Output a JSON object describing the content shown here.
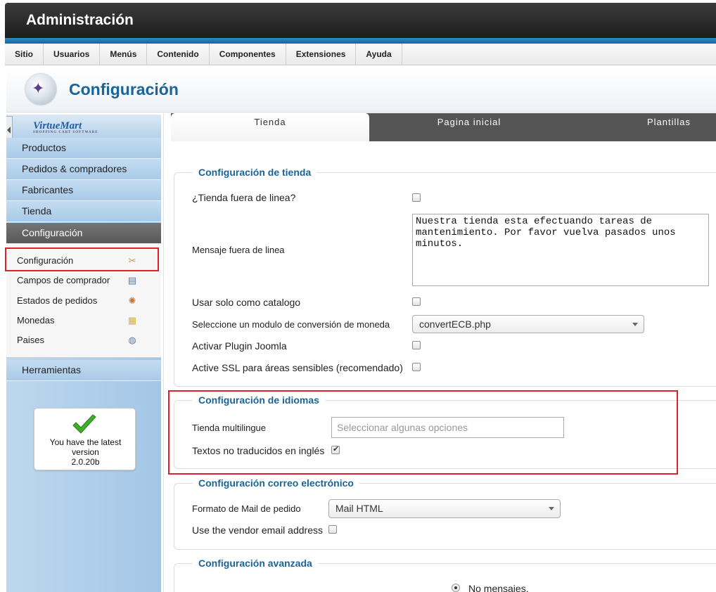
{
  "header": {
    "title": "Administración"
  },
  "menu": [
    "Sitio",
    "Usuarios",
    "Menús",
    "Contenido",
    "Componentes",
    "Extensiones",
    "Ayuda"
  ],
  "page": {
    "title": "Configuración",
    "logo_icon": "virtuemart-config-icon"
  },
  "sidebar": {
    "brand": "VirtueMart",
    "brand_tagline": "SHOPPING CART SOFTWARE",
    "nav": [
      "Productos",
      "Pedidos & compradores",
      "Fabricantes",
      "Tienda",
      "Configuración",
      "Herramientas"
    ],
    "active_nav": "Configuración",
    "sub_items": [
      {
        "label": "Configuración",
        "icon": "tools-icon"
      },
      {
        "label": "Campos de comprador",
        "icon": "user-fields-icon"
      },
      {
        "label": "Estados de pedidos",
        "icon": "order-status-icon"
      },
      {
        "label": "Monedas",
        "icon": "coins-icon"
      },
      {
        "label": "Paises",
        "icon": "globe-icon"
      }
    ],
    "version": {
      "line1": "You have the latest",
      "line2": "version",
      "line3": "2.0.20b"
    }
  },
  "tabs": [
    "Tienda",
    "Pagina inicial",
    "Plantillas"
  ],
  "selected_tab": "Tienda",
  "store_config": {
    "legend": "Configuración de tienda",
    "offline_label": "¿Tienda fuera de linea?",
    "offline_checked": false,
    "offline_msg_label": "Mensaje fuera de linea",
    "offline_msg_value": "Nuestra tienda esta efectuando tareas de\nmantenimiento. Por favor vuelva pasados unos\nminutos.",
    "catalog_label": "Usar solo como catalogo",
    "catalog_checked": false,
    "currency_module_label": "Seleccione un modulo de conversión de moneda",
    "currency_module_value": "convertECB.php",
    "joomla_plugin_label": "Activar Plugin Joomla",
    "joomla_plugin_checked": false,
    "ssl_label": "Active SSL para áreas sensibles (recomendado)",
    "ssl_checked": false
  },
  "lang_config": {
    "legend": "Configuración de idiomas",
    "multilingual_label": "Tienda multilingue",
    "multilingual_placeholder": "Seleccionar algunas opciones",
    "untranslated_label": "Textos no traducidos en inglés",
    "untranslated_checked": true
  },
  "email_config": {
    "legend": "Configuración correo electrónico",
    "format_label": "Formato de Mail de pedido",
    "format_value": "Mail HTML",
    "vendor_email_label": "Use the vendor email address",
    "vendor_email_checked": false
  },
  "advanced_config": {
    "legend": "Configuración avanzada",
    "radio_label": "No mensajes."
  },
  "colors": {
    "accent": "#1a6496",
    "highlight": "#d9232d",
    "sidebar": "#a9cae8",
    "active_nav": "#666666"
  }
}
